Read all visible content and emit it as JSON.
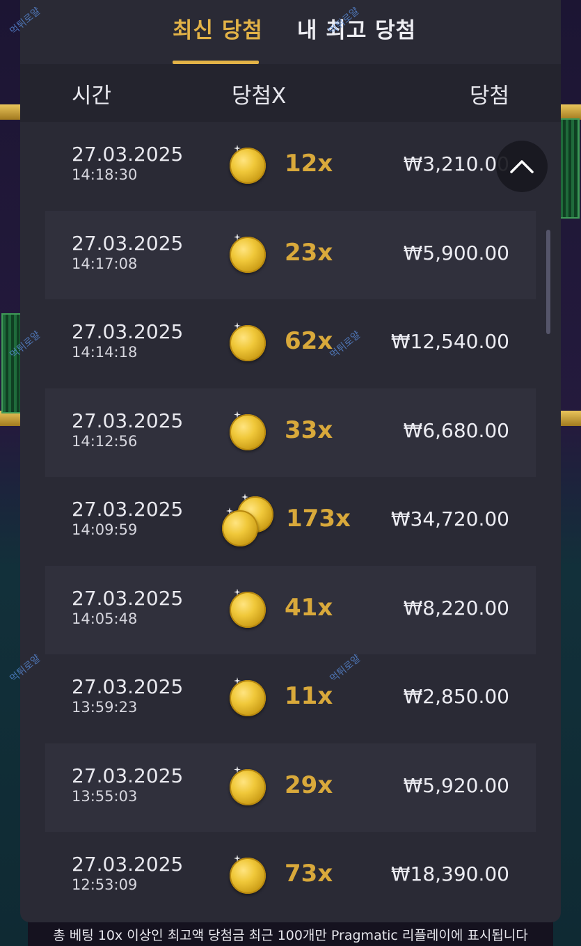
{
  "tabs": [
    {
      "label": "최신 당첨",
      "active": true
    },
    {
      "label": "내 최고 당첨",
      "active": false
    }
  ],
  "columns": {
    "time": "시간",
    "multiplier": "당첨X",
    "win": "당첨"
  },
  "rows": [
    {
      "date": "27.03.2025",
      "time": "14:18:30",
      "multiplier": "12x",
      "amount": "₩3,210.00",
      "coins": 1
    },
    {
      "date": "27.03.2025",
      "time": "14:17:08",
      "multiplier": "23x",
      "amount": "₩5,900.00",
      "coins": 1
    },
    {
      "date": "27.03.2025",
      "time": "14:14:18",
      "multiplier": "62x",
      "amount": "₩12,540.00",
      "coins": 1
    },
    {
      "date": "27.03.2025",
      "time": "14:12:56",
      "multiplier": "33x",
      "amount": "₩6,680.00",
      "coins": 1
    },
    {
      "date": "27.03.2025",
      "time": "14:09:59",
      "multiplier": "173x",
      "amount": "₩34,720.00",
      "coins": 2
    },
    {
      "date": "27.03.2025",
      "time": "14:05:48",
      "multiplier": "41x",
      "amount": "₩8,220.00",
      "coins": 1
    },
    {
      "date": "27.03.2025",
      "time": "13:59:23",
      "multiplier": "11x",
      "amount": "₩2,850.00",
      "coins": 1
    },
    {
      "date": "27.03.2025",
      "time": "13:55:03",
      "multiplier": "29x",
      "amount": "₩5,920.00",
      "coins": 1
    },
    {
      "date": "27.03.2025",
      "time": "12:53:09",
      "multiplier": "73x",
      "amount": "₩18,390.00",
      "coins": 1
    }
  ],
  "footer": "총 베팅 10x 이상인 최고액 당첨금 최근 100개만 Pragmatic 리플레이에 표시됩니다",
  "watermark": "먹튀로얄",
  "icons": {
    "scroll_top": "chevron-up-icon",
    "coin": "gold-coin-icon"
  },
  "colors": {
    "accent": "#e3b347",
    "panel": "#2a2a35",
    "row_alt": "#30303c"
  }
}
